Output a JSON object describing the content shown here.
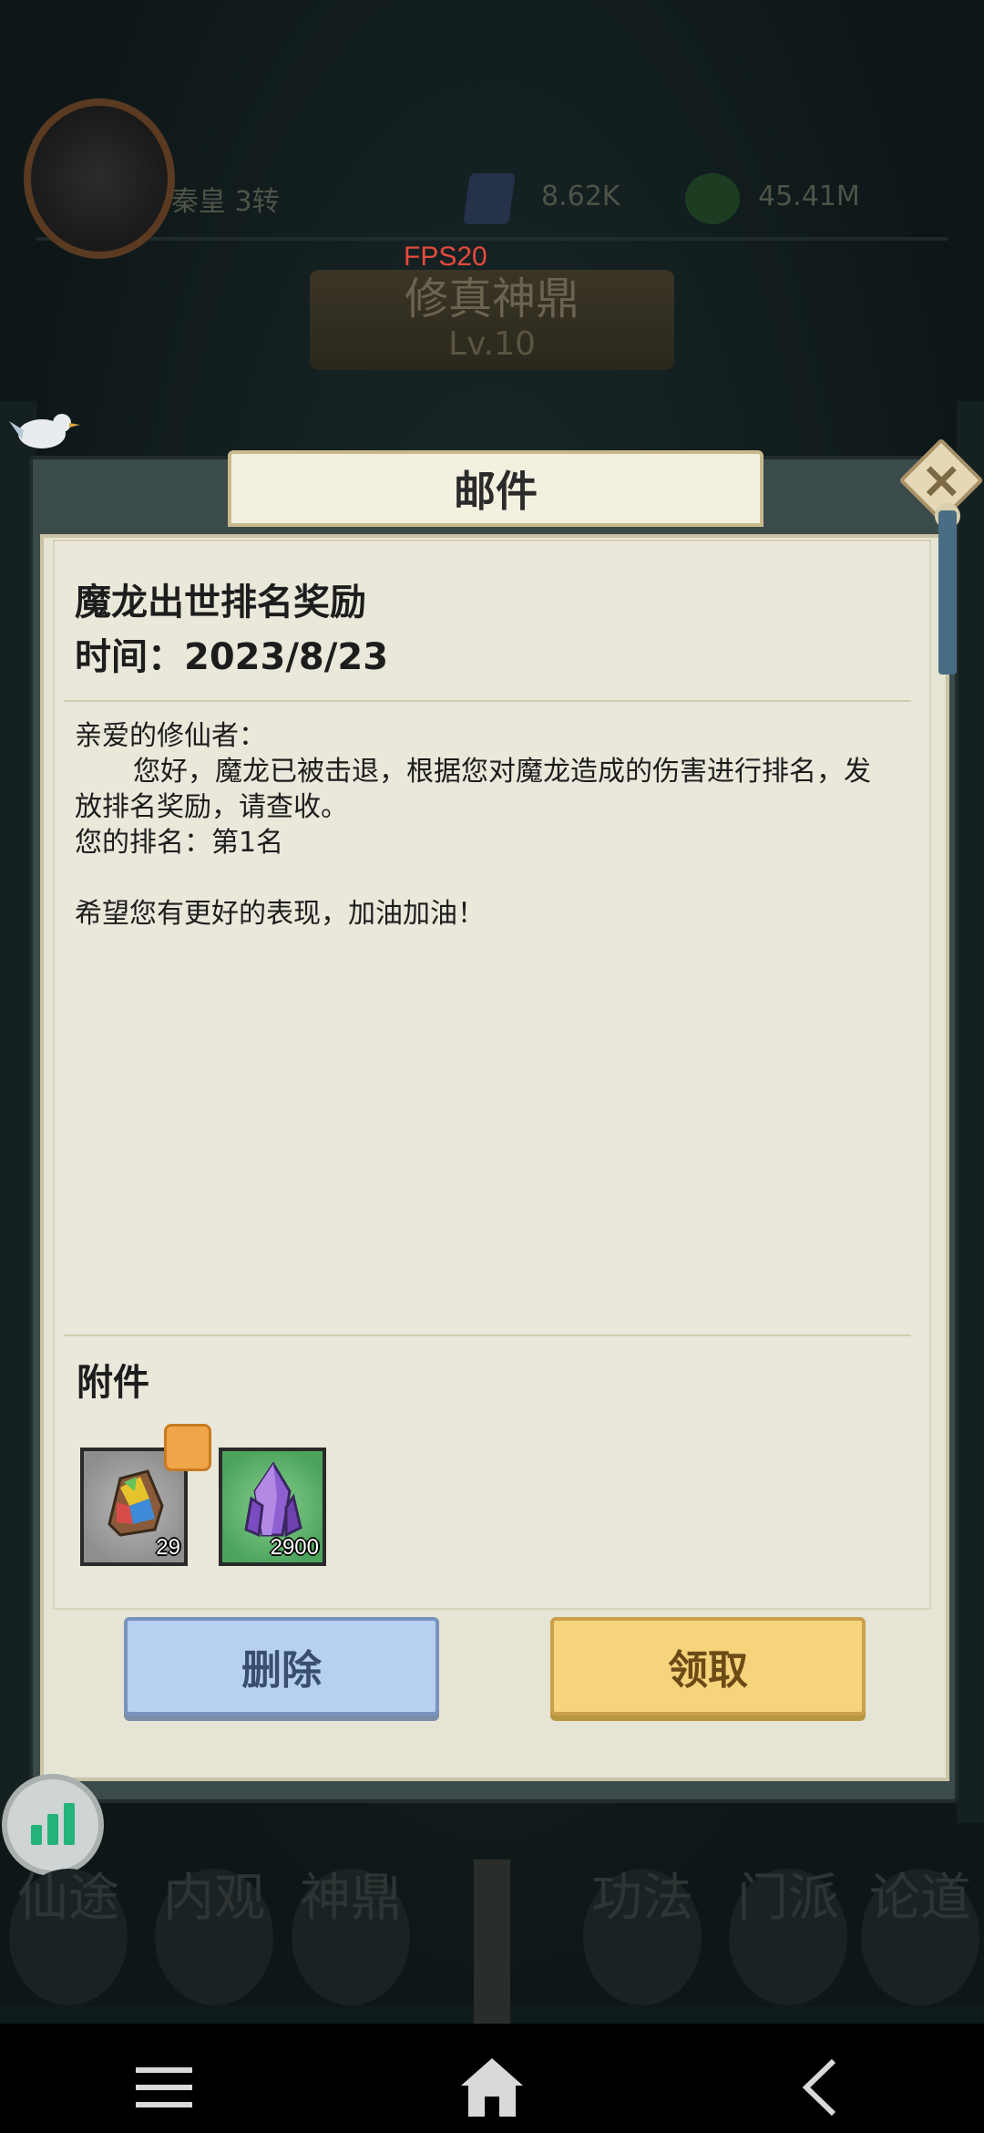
{
  "hud": {
    "player_name": "秦皇 3转",
    "resource1_value": "8.62K",
    "resource2_value": "45.41M",
    "fps": "FPS20",
    "building_name": "修真神鼎",
    "building_level": "Lv.10"
  },
  "dialog": {
    "title": "邮件",
    "mail_subject": "魔龙出世排名奖励",
    "mail_time_label": "时间：2023/8/23",
    "body": {
      "greeting": "亲爱的修仙者：",
      "para1": "您好，魔龙已被击退，根据您对魔龙造成的伤害进行排名，发放排名奖励，请查收。",
      "rank": "您的排名：第1名",
      "closing": "希望您有更好的表现，加油加油！"
    },
    "attachments_label": "附件",
    "attachments": [
      {
        "icon": "colorful-ore-icon",
        "count": "29"
      },
      {
        "icon": "purple-crystal-icon",
        "count": "2900"
      }
    ],
    "delete_label": "删除",
    "claim_label": "领取"
  },
  "bottom_nav": {
    "items": [
      "仙途",
      "内观",
      "神鼎",
      "功法",
      "门派",
      "论道"
    ]
  },
  "colors": {
    "delete_button": "#b7cff0",
    "claim_button": "#f6d47c",
    "fps_text": "#e64b3c"
  }
}
